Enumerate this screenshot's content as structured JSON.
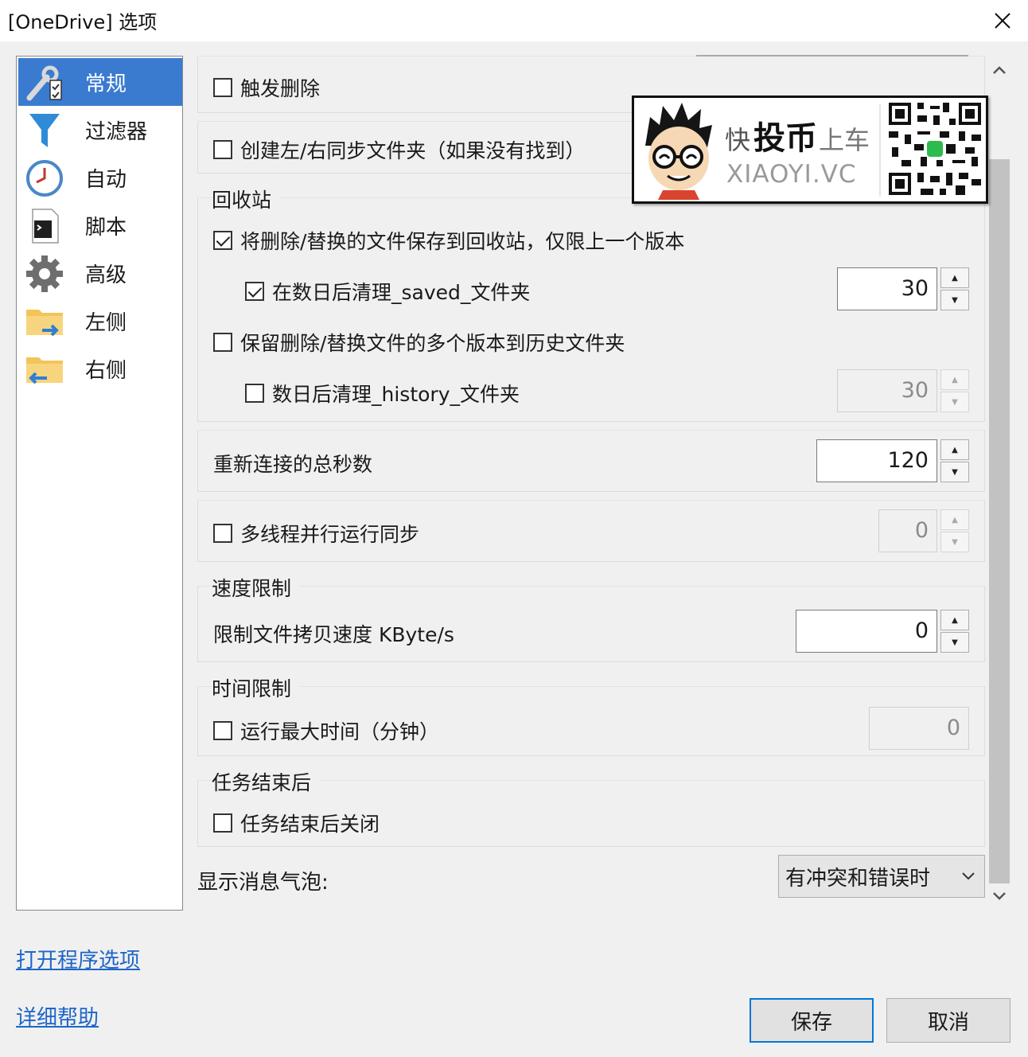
{
  "window": {
    "title": "[OneDrive] 选项"
  },
  "sidebar": {
    "items": [
      {
        "label": "常规",
        "icon": "wrench-checklist-icon",
        "active": true
      },
      {
        "label": "过滤器",
        "icon": "funnel-icon"
      },
      {
        "label": "自动",
        "icon": "clock-icon"
      },
      {
        "label": "脚本",
        "icon": "script-terminal-icon"
      },
      {
        "label": "高级",
        "icon": "gear-icon"
      },
      {
        "label": "左侧",
        "icon": "folder-arrow-right-icon"
      },
      {
        "label": "右侧",
        "icon": "folder-arrow-left-icon"
      }
    ]
  },
  "options": {
    "trigger_delete": {
      "label": "触发删除",
      "checked": false
    },
    "create_folders": {
      "label": "创建左/右同步文件夹（如果没有找到）",
      "checked": false
    },
    "recycle": {
      "title": "回收站",
      "save_to_recycle": {
        "label": "将删除/替换的文件保存到回收站，仅限上一个版本",
        "checked": true
      },
      "cleanup_saved": {
        "label": "在数日后清理_saved_文件夹",
        "checked": true,
        "value": "30"
      },
      "keep_versions": {
        "label": "保留删除/替换文件的多个版本到历史文件夹",
        "checked": false
      },
      "cleanup_history": {
        "label": "数日后清理_history_文件夹",
        "checked": false,
        "value": "30"
      }
    },
    "reconnect": {
      "label": "重新连接的总秒数",
      "value": "120"
    },
    "multithread": {
      "label": "多线程并行运行同步",
      "checked": false,
      "value": "0"
    },
    "speed": {
      "title": "速度限制",
      "label": "限制文件拷贝速度 KByte/s",
      "value": "0"
    },
    "time": {
      "title": "时间限制",
      "label": "运行最大时间（分钟）",
      "checked": false,
      "value": "0"
    },
    "after_task": {
      "title": "任务结束后",
      "label": "任务结束后关闭",
      "checked": false
    },
    "bubble": {
      "label": "显示消息气泡:",
      "value": "有冲突和错误时"
    }
  },
  "links": {
    "open_program_options": "打开程序选项",
    "help": "详细帮助"
  },
  "buttons": {
    "save": "保存",
    "cancel": "取消"
  },
  "ad": {
    "brand_kuai": "快",
    "brand_tb": "投币",
    "brand_sc": "上车",
    "domain": "XIAOYI.VC"
  },
  "colors": {
    "accent": "#0078d7",
    "nav_active": "#3a7bd0",
    "link": "#1e66c8"
  }
}
